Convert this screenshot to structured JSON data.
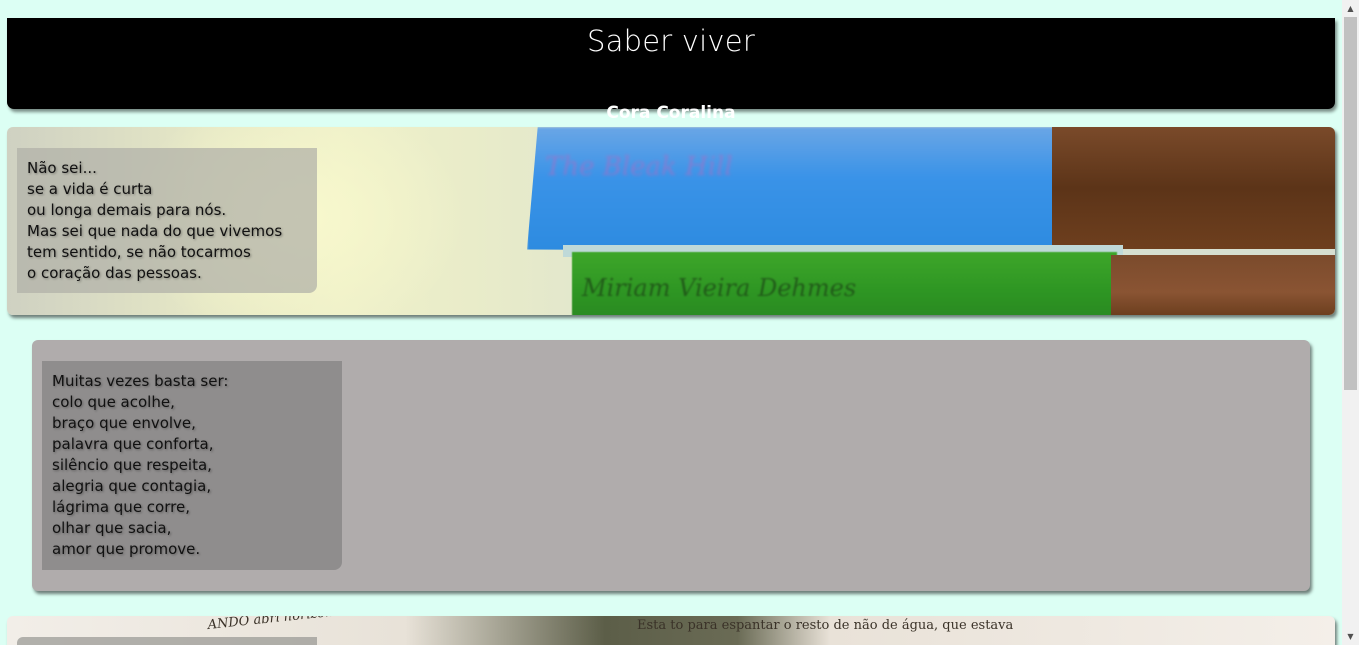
{
  "header": {
    "title": "Saber viver",
    "author": "Cora Coralina"
  },
  "sections": [
    {
      "lines": [
        "Não sei...",
        "se a vida é curta",
        "ou longa demais para nós.",
        "Mas sei que nada do que vivemos",
        "tem sentido, se não tocarmos",
        "o coração das pessoas."
      ],
      "background_image": "stacked-books-photo",
      "book_texts": [
        "The Bleak Hill",
        "Miriam Vieira Dehmes"
      ]
    },
    {
      "lines": [
        "Muitas vezes basta ser:",
        "colo que acolhe,",
        "braço que envolve,",
        "palavra que conforta,",
        "silêncio que respeita,",
        "alegria que contagia,",
        "lágrima que corre,",
        "olhar que sacia,",
        "amor que promove."
      ],
      "background_color": "#b0acac"
    },
    {
      "background_image": "open-book-photo",
      "printed_text": [
        "ANDO abri horizonte. sustadora. Vis mistério. onde eu descansava",
        "Esta to para espantar o resto de não de água, que estava"
      ]
    }
  ],
  "colors": {
    "page_background": "#dcfff4",
    "header_background": "#000000",
    "header_text": "#ffffff"
  },
  "scrollbar": {
    "up_arrow": "▲",
    "down_arrow": "▼"
  }
}
